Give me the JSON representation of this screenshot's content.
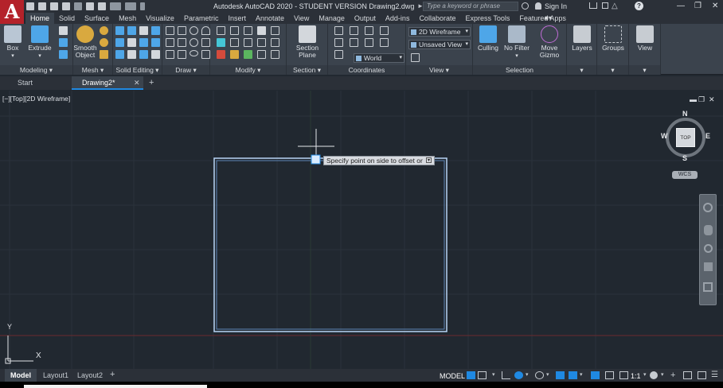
{
  "app": {
    "title": "Autodesk AutoCAD 2020 - STUDENT VERSION    Drawing2.dwg",
    "logo": "A",
    "search_placeholder": "Type a keyword or phrase",
    "sign_in": "Sign In"
  },
  "ribbon_tabs": [
    "Home",
    "Solid",
    "Surface",
    "Mesh",
    "Visualize",
    "Parametric",
    "Insert",
    "Annotate",
    "View",
    "Manage",
    "Output",
    "Add-ins",
    "Collaborate",
    "Express Tools",
    "Featured Apps"
  ],
  "ribbon": {
    "panels": {
      "modeling": "Modeling",
      "mesh": "Mesh",
      "solid_editing": "Solid Editing",
      "draw": "Draw",
      "modify": "Modify",
      "section": "Section",
      "coordinates": "Coordinates",
      "view": "View",
      "selection": "Selection"
    },
    "buttons": {
      "box": "Box",
      "extrude": "Extrude",
      "smooth_object_1": "Smooth",
      "smooth_object_2": "Object",
      "section_plane_1": "Section",
      "section_plane_2": "Plane",
      "culling": "Culling",
      "no_filter": "No Filter",
      "move_gizmo_1": "Move",
      "move_gizmo_2": "Gizmo",
      "layers": "Layers",
      "groups": "Groups",
      "view": "View"
    },
    "combos": {
      "visual_style": "2D Wireframe",
      "named_view": "Unsaved View",
      "ucs": "World"
    }
  },
  "doc_tabs": [
    "Start",
    "Drawing2*"
  ],
  "viewport": {
    "label": "[−][Top][2D Wireframe]",
    "tooltip": "Specify point on side to offset or",
    "viewcube": {
      "top": "TOP",
      "n": "N",
      "s": "S",
      "e": "E",
      "w": "W",
      "wcs": "WCS"
    },
    "ucs": {
      "y": "Y",
      "x": "X"
    }
  },
  "layout_tabs": [
    "Model",
    "Layout1",
    "Layout2"
  ],
  "status": {
    "model": "MODEL",
    "scale": "1:1"
  },
  "colors": {
    "viewport_bg": "#212830",
    "ribbon_bg": "#3b434d",
    "accent": "#1f89e2",
    "selection_outline": "#b8d4f5",
    "logo_red": "#b4222a"
  }
}
